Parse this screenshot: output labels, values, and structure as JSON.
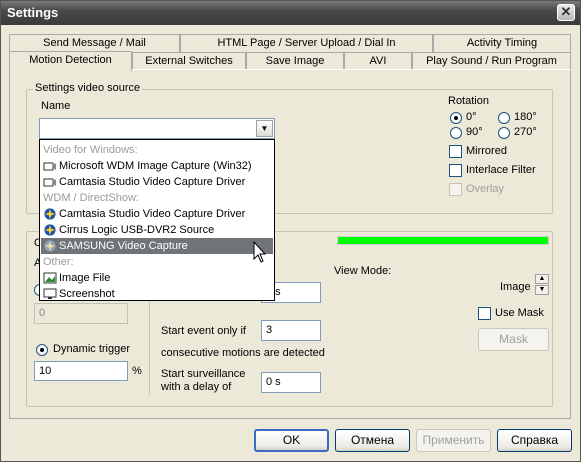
{
  "window": {
    "title": "Settings",
    "close": "✕"
  },
  "tabs_row1": [
    "Send Message / Mail",
    "HTML Page / Server Upload / Dial In",
    "Activity Timing"
  ],
  "tabs_row2": [
    "Motion Detection",
    "External Switches",
    "Save Image",
    "AVI",
    "Play Sound / Run Program"
  ],
  "video_source": {
    "group_label": "Settings video source",
    "name_label": "Name",
    "name_value": ""
  },
  "rotation": {
    "label": "Rotation",
    "options": [
      "0°",
      "180°",
      "90°",
      "270°"
    ],
    "selected": "0°",
    "mirrored": "Mirrored",
    "interlace": "Interlace Filter",
    "overlay": "Overlay"
  },
  "dropdown": {
    "items": [
      {
        "text": "Video for Windows:",
        "type": "header"
      },
      {
        "text": "Microsoft WDM Image Capture (Win32)",
        "type": "item",
        "icon": "camera-icon"
      },
      {
        "text": "Camtasia Studio Video Capture Driver",
        "type": "item",
        "icon": "camera-icon"
      },
      {
        "text": "WDM / DirectShow:",
        "type": "header"
      },
      {
        "text": "Camtasia Studio Video Capture Driver",
        "type": "item",
        "icon": "directshow-icon"
      },
      {
        "text": "Cirrus Logic USB-DVR2 Source",
        "type": "item",
        "icon": "directshow-icon"
      },
      {
        "text": "SAMSUNG Video Capture",
        "type": "item",
        "icon": "directshow-icon",
        "selected": true
      },
      {
        "text": "Other:",
        "type": "header"
      },
      {
        "text": "Image File",
        "type": "item",
        "icon": "image-file-icon"
      },
      {
        "text": "Screenshot",
        "type": "item",
        "icon": "screenshot-icon"
      }
    ]
  },
  "motion": {
    "partial_group_letter": "C",
    "partial_a": "A",
    "disabled_field_value": "0",
    "dynamic_trigger_label": "Dynamic trigger",
    "dynamic_trigger_value": "10",
    "percent": "%",
    "hidden_field_value": "5 s",
    "start_event_label": "Start event only if",
    "start_event_value": "3",
    "consecutive_label": "consecutive motions are detected",
    "surveillance_label_1": "Start surveillance",
    "surveillance_label_2": "with a delay of",
    "surveillance_value": "0 s",
    "level_bar_fraction": 1.0,
    "level_bar_color": "#00ff00"
  },
  "view_mode": {
    "label": "View Mode:",
    "value": "Image",
    "use_mask": "Use Mask",
    "mask_button": "Mask"
  },
  "buttons": {
    "ok": "OK",
    "cancel": "Отмена",
    "apply": "Применить",
    "help": "Справка"
  }
}
